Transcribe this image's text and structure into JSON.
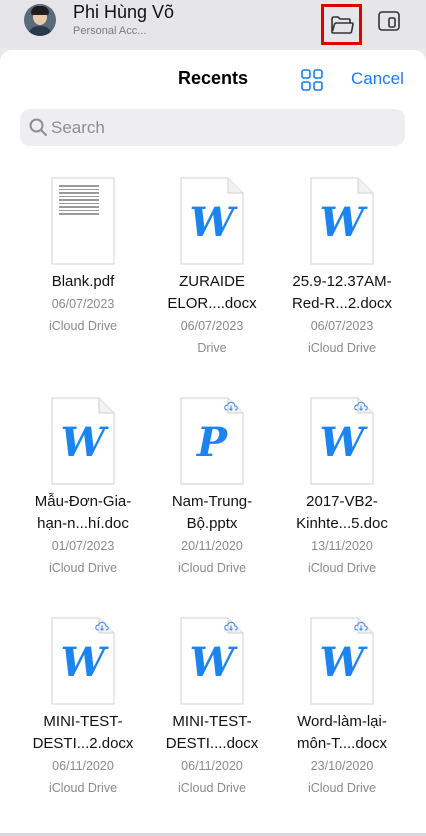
{
  "account": {
    "name": "Phi Hùng Võ",
    "subtitle": "Personal Acc...",
    "folder_icon": "folder-icon",
    "device_icon": "device-icon",
    "highlight_color": "#e10000"
  },
  "sheet": {
    "title": "Recents",
    "grid_icon": "grid-icon",
    "cancel_label": "Cancel",
    "accent_color": "#1a7cf0"
  },
  "search": {
    "placeholder": "Search"
  },
  "files": [
    {
      "name1": "Blank.pdf",
      "name2": "",
      "date": "06/07/2023",
      "location": "iCloud Drive",
      "type": "pdf",
      "letter": "",
      "cloud": false
    },
    {
      "name1": "ZURAIDE",
      "name2": "ELOR....docx",
      "date": "06/07/2023",
      "location": "Drive",
      "type": "word",
      "letter": "W",
      "cloud": false
    },
    {
      "name1": "25.9-12.37AM-",
      "name2": "Red-R...2.docx",
      "date": "06/07/2023",
      "location": "iCloud Drive",
      "type": "word",
      "letter": "W",
      "cloud": false
    },
    {
      "name1": "Mẫu-Đơn-Gia-",
      "name2": "hạn-n...hí.doc",
      "date": "01/07/2023",
      "location": "iCloud Drive",
      "type": "word",
      "letter": "W",
      "cloud": false
    },
    {
      "name1": "Nam-Trung-",
      "name2": "Bộ.pptx",
      "date": "20/11/2020",
      "location": "iCloud Drive",
      "type": "ppt",
      "letter": "P",
      "cloud": true
    },
    {
      "name1": "2017-VB2-",
      "name2": "Kinhte...5.doc",
      "date": "13/11/2020",
      "location": "iCloud Drive",
      "type": "word",
      "letter": "W",
      "cloud": true
    },
    {
      "name1": "MINI-TEST-",
      "name2": "DESTI...2.docx",
      "date": "06/11/2020",
      "location": "iCloud Drive",
      "type": "word",
      "letter": "W",
      "cloud": true
    },
    {
      "name1": "MINI-TEST-",
      "name2": "DESTI....docx",
      "date": "06/11/2020",
      "location": "iCloud Drive",
      "type": "word",
      "letter": "W",
      "cloud": true
    },
    {
      "name1": "Word-làm-lại-",
      "name2": "môn-T....docx",
      "date": "23/10/2020",
      "location": "iCloud Drive",
      "type": "word",
      "letter": "W",
      "cloud": true
    }
  ]
}
